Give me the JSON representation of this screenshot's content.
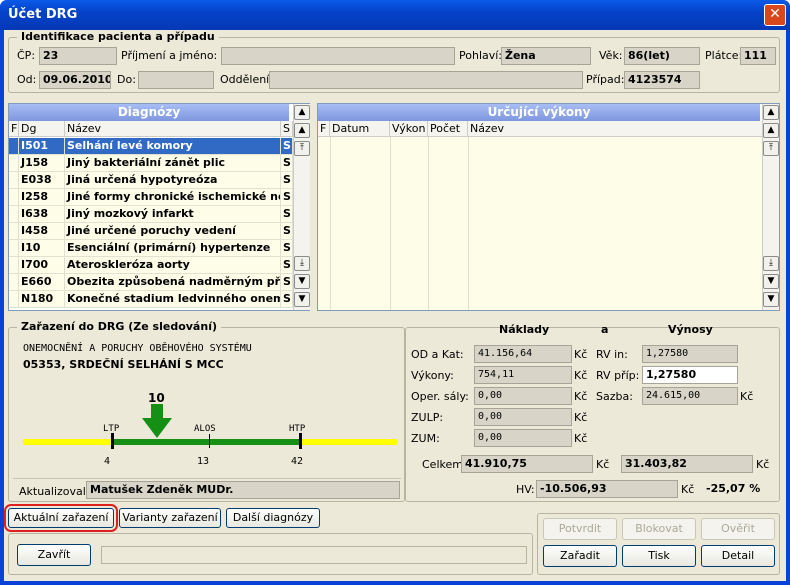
{
  "window": {
    "title": "Účet DRG",
    "close": "✕"
  },
  "patient": {
    "group_title": "Identifikace pacienta a případu",
    "cp_label": "ČP:",
    "cp_value": "23",
    "name_label": "Příjmení a jméno:",
    "name_value": "",
    "sex_label": "Pohlaví:",
    "sex_value": "Žena",
    "age_label": "Věk:",
    "age_value": "86(let)",
    "payer_label": "Plátce:",
    "payer_value": "111",
    "from_label": "Od:",
    "from_value": "09.06.2010",
    "to_label": "Do:",
    "to_value": "",
    "dept_label": "Oddělení:",
    "dept_value": "",
    "case_label": "Případ:",
    "case_value": "4123574"
  },
  "diagnoses": {
    "title": "Diagnózy",
    "columns": [
      "F",
      "Dg",
      "Název",
      "S"
    ],
    "rows": [
      {
        "f": "",
        "dg": "I501",
        "name": "Selhání levé komory",
        "s": "S"
      },
      {
        "f": "",
        "dg": "J158",
        "name": "Jiný bakteriální zánět plic",
        "s": "S"
      },
      {
        "f": "",
        "dg": "E038",
        "name": "Jiná určená hypotyreóza",
        "s": "S"
      },
      {
        "f": "",
        "dg": "I258",
        "name": "Jiné formy chronické ischemické nem",
        "s": "S"
      },
      {
        "f": "",
        "dg": "I638",
        "name": "Jiný mozkový infarkt",
        "s": "S"
      },
      {
        "f": "",
        "dg": "I458",
        "name": "Jiné určené poruchy vedení",
        "s": "S"
      },
      {
        "f": "",
        "dg": "I10",
        "name": "Esenciální (primární) hypertenze",
        "s": "S"
      },
      {
        "f": "",
        "dg": "I700",
        "name": "Ateroskleróza aorty",
        "s": "S"
      },
      {
        "f": "",
        "dg": "E660",
        "name": "Obezita způsobená nadměrným příjme",
        "s": "S"
      },
      {
        "f": "",
        "dg": "N180",
        "name": "Konečné stadium ledvinného onemoc",
        "s": "S"
      }
    ]
  },
  "procedures": {
    "title": "Určující výkony",
    "columns": [
      "F",
      "Datum",
      "Výkon",
      "Počet",
      "Název"
    ]
  },
  "drg": {
    "group_title": "Zařazení do DRG (Ze sledování)",
    "line1": "ONEMOCNĚNÍ A PORUCHY OBĚHOVÉHO SYSTÉMU",
    "line2": "05353, SRDEČNÍ SELHÁNÍ S MCC",
    "los_current": "10",
    "ltp_label": "LTP",
    "alos_label": "ALOS",
    "htp_label": "HTP",
    "ltp_value": "4",
    "alos_value": "13",
    "htp_value": "42",
    "updated_label": "Aktualizoval:",
    "updated_value": "Matušek Zdeněk MUDr."
  },
  "costs": {
    "header_costs": "Náklady",
    "header_and": "a",
    "header_revenue": "Výnosy",
    "od_label": "OD a Kat:",
    "od_value": "41.156,64",
    "vykony_label": "Výkony:",
    "vykony_value": "754,11",
    "oper_label": "Oper. sály:",
    "oper_value": "0,00",
    "zulp_label": "ZULP:",
    "zulp_value": "0,00",
    "zum_label": "ZUM:",
    "zum_value": "0,00",
    "currency": "Kč",
    "rvin_label": "RV in:",
    "rvin_value": "1,27580",
    "rvprip_label": "RV příp:",
    "rvprip_value": "1,27580",
    "sazba_label": "Sazba:",
    "sazba_value": "24.615,00",
    "total_label": "Celkem:",
    "total_costs": "41.910,75",
    "total_revenue": "31.403,82",
    "hv_label": "HV:",
    "hv_value": "-10.506,93",
    "hv_percent": "-25,07 %"
  },
  "buttons": {
    "current": "Aktuální zařazení",
    "variants": "Varianty zařazení",
    "other": "Další diagnózy",
    "close": "Zavřít",
    "approve": "Potvrdit",
    "block": "Blokovat",
    "verify": "Ověřit",
    "assign": "Zařadit",
    "print": "Tisk",
    "detail": "Detail"
  }
}
